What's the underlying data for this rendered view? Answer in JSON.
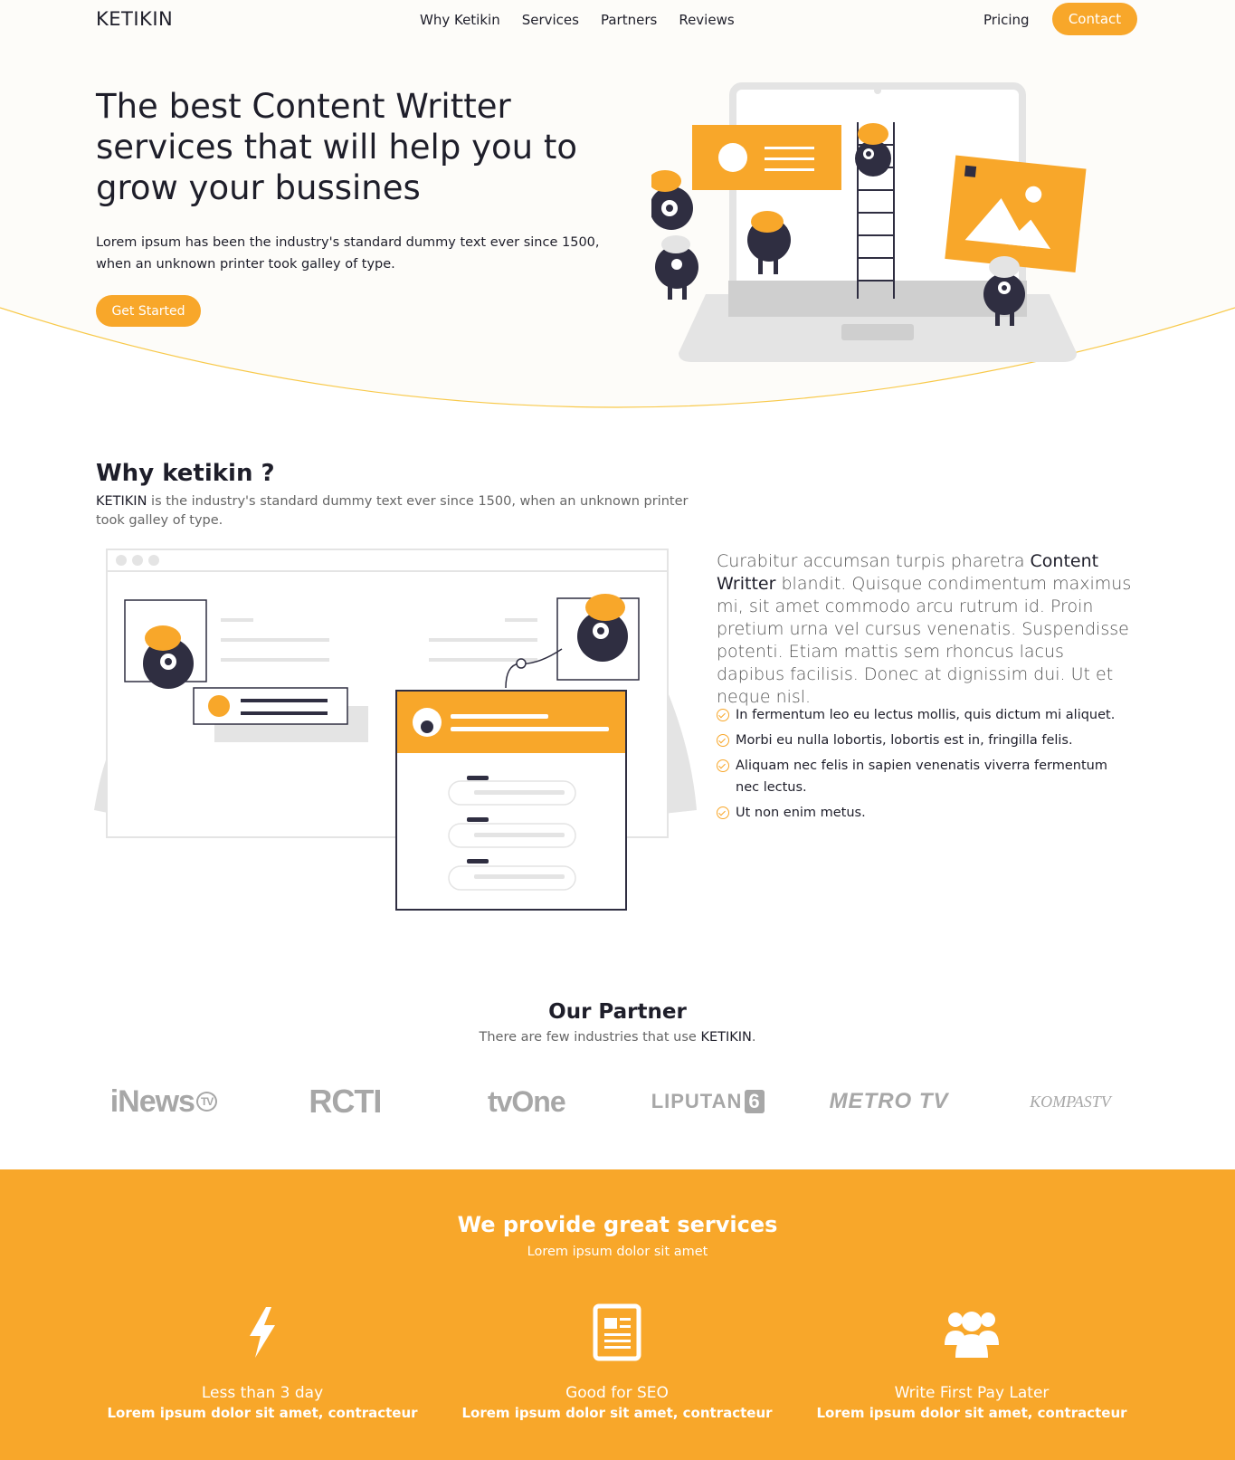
{
  "nav": {
    "logo": "KETIKIN",
    "links": [
      "Why Ketikin",
      "Services",
      "Partners",
      "Reviews"
    ],
    "pricing": "Pricing",
    "contact": "Contact"
  },
  "hero": {
    "title": "The best Content Writter services that will help you to grow your bussines",
    "subtitle": "Lorem ipsum has been the industry's standard dummy text ever since 1500, when an unknown printer took galley of type.",
    "button": "Get Started"
  },
  "why": {
    "title": "Why ketikin ?",
    "brand": "KETIKIN",
    "subtitle_rest": " is the industry's standard dummy text ever since 1500, when an unknown printer took galley of type.",
    "para_start": "Curabitur accumsan turpis pharetra ",
    "para_bold": "Content Writter",
    "para_end": " blandit. Quisque condimentum maximus mi, sit amet commodo arcu rutrum id. Proin pretium urna vel cursus venenatis. Suspendisse potenti. Etiam mattis sem rhoncus lacus dapibus facilisis. Donec at dignissim dui. Ut et neque nisl.",
    "list": [
      "In fermentum leo eu lectus mollis, quis dictum mi aliquet.",
      "Morbi eu nulla lobortis, lobortis est in, fringilla felis.",
      "Aliquam nec felis in sapien venenatis viverra fermentum nec lectus.",
      "Ut non enim metus."
    ]
  },
  "partners": {
    "title": "Our Partner",
    "subtitle_start": "There are few industries that use ",
    "brand": "KETIKIN",
    "subtitle_end": ".",
    "logos": {
      "inews": "iNews",
      "inews_tv": "TV",
      "rcti": "RCTI",
      "tvone": "tvOne",
      "liputan": "LIPUTAN",
      "liputan_num": "6",
      "metro": "METRO TV",
      "kompas": "KOMPASTV"
    }
  },
  "services": {
    "title": "We provide great services",
    "subtitle": "Lorem ipsum dolor sit amet",
    "items": [
      {
        "name": "Less than 3 day",
        "desc": "Lorem ipsum dolor sit amet, contracteur",
        "icon": "lightning-icon"
      },
      {
        "name": "Good for SEO",
        "desc": "Lorem ipsum dolor sit amet, contracteur",
        "icon": "document-icon"
      },
      {
        "name": "Write First Pay Later",
        "desc": "Lorem ipsum dolor sit amet, contracteur",
        "icon": "users-icon"
      }
    ]
  },
  "colors": {
    "accent": "#f8a72a",
    "dark": "#2f2e41"
  }
}
